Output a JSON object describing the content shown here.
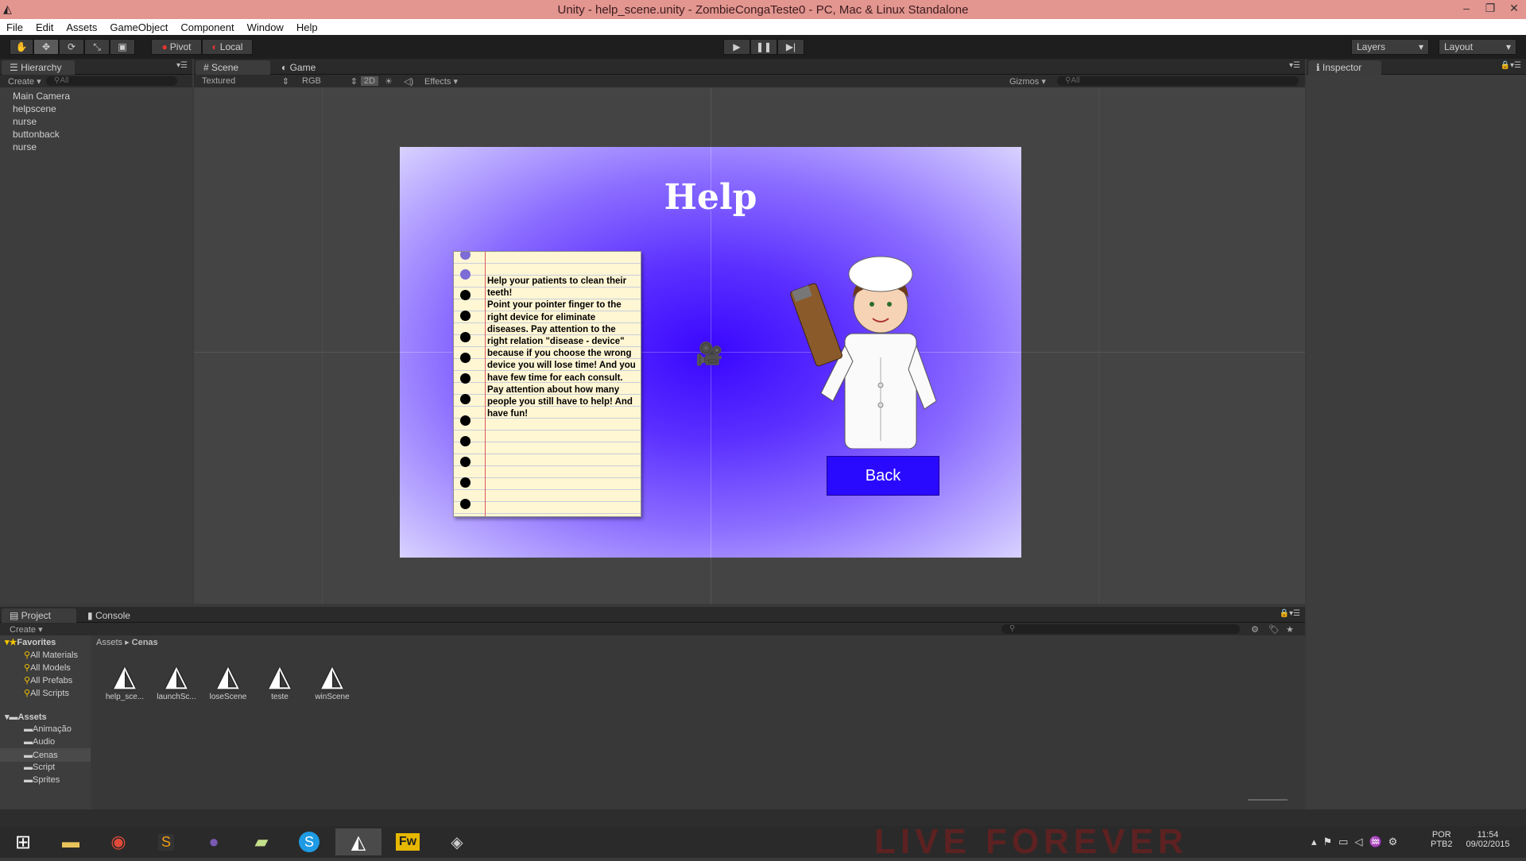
{
  "window": {
    "title": "Unity - help_scene.unity - ZombieCongaTeste0 - PC, Mac & Linux Standalone",
    "min": "–",
    "max": "❐",
    "close": "✕"
  },
  "menu": [
    "File",
    "Edit",
    "Assets",
    "GameObject",
    "Component",
    "Window",
    "Help"
  ],
  "toolbar": {
    "pivot": "Pivot",
    "local": "Local",
    "layers": "Layers",
    "layout": "Layout"
  },
  "hierarchy": {
    "tab": "Hierarchy",
    "create": "Create",
    "search_placeholder": "All",
    "items": [
      "Main Camera",
      "helpscene",
      "nurse",
      "buttonback",
      "nurse"
    ]
  },
  "scene": {
    "tab_scene": "Scene",
    "tab_game": "Game",
    "render_mode": "Textured",
    "color_mode": "RGB",
    "mode_2d": "2D",
    "effects": "Effects",
    "gizmos": "Gizmos",
    "search_placeholder": "All",
    "help_title": "Help",
    "note_text": "Help your patients to clean their teeth!\nPoint your pointer finger to the right device for eliminate diseases. Pay attention to the right relation \"disease - device\" because if you choose the wrong device you will lose time! And you have few time for each consult. Pay attention about how many people you still have to help! And have fun!",
    "back_button": "Back"
  },
  "inspector": {
    "tab": "Inspector"
  },
  "project": {
    "tab_project": "Project",
    "tab_console": "Console",
    "create": "Create",
    "favorites_label": "Favorites",
    "favorites": [
      "All Materials",
      "All Models",
      "All Prefabs",
      "All Scripts"
    ],
    "assets_label": "Assets",
    "folders": [
      "Animação",
      "Audio",
      "Cenas",
      "Script",
      "Sprites"
    ],
    "selected_folder": "Cenas",
    "breadcrumb": [
      "Assets",
      "Cenas"
    ],
    "files": [
      "help_sce...",
      "launchSc...",
      "loseScene",
      "teste",
      "winScene"
    ]
  },
  "taskbar": {
    "lang_top": "POR",
    "lang_bottom": "PTB2",
    "time": "11:54",
    "date": "09/02/2015",
    "wallpaper_text": "LIVE FOREVER"
  },
  "colors": {
    "title_bar": "#e39590",
    "scene_bg_center": "#3c0aff",
    "back_button": "#2a0aff"
  }
}
